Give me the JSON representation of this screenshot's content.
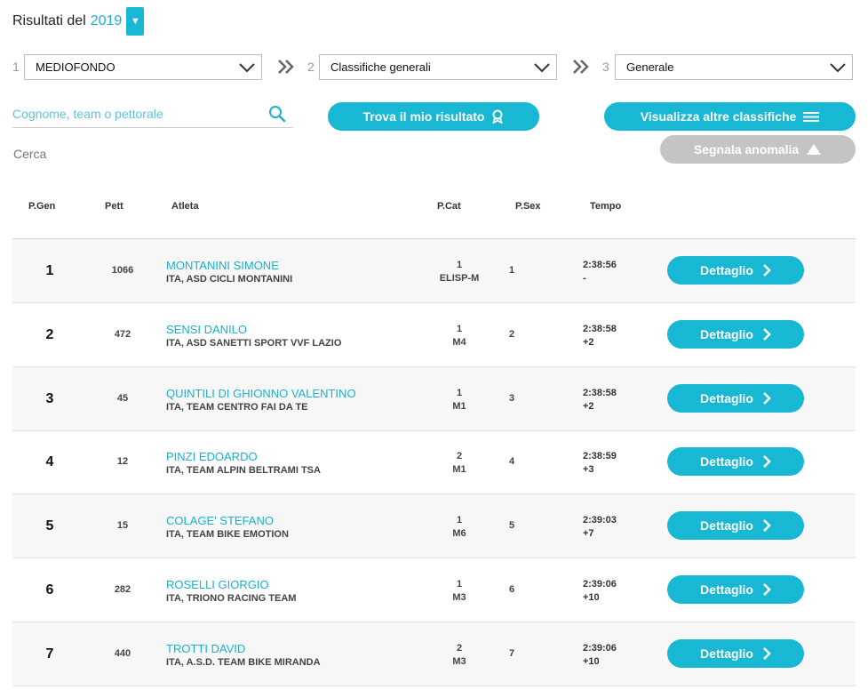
{
  "header": {
    "title": "Risultati del",
    "year": "2019",
    "year_toggle_glyph": "▼"
  },
  "steps": [
    {
      "num": "1",
      "value": "MEDIOFONDO"
    },
    {
      "num": "2",
      "value": "Classifiche generali"
    },
    {
      "num": "3",
      "value": "Generale"
    }
  ],
  "search": {
    "placeholder": "Cognome, team o pettorale",
    "value": "",
    "cerca_label": "Cerca"
  },
  "buttons": {
    "find_result": "Trova il mio risultato",
    "other_rankings": "Visualizza altre classifiche",
    "report_anomaly": "Segnala anomalia"
  },
  "table": {
    "columns": [
      "P.Gen",
      "Pett",
      "Atleta",
      "P.Cat",
      "P.Sex",
      "Tempo"
    ],
    "detail_label": "Dettaglio",
    "rows": [
      {
        "pgen": "1",
        "pett": "1066",
        "name": "MONTANINI SIMONE",
        "team": "ITA, ASD CICLI MONTANINI",
        "pcat_pos": "1",
        "pcat_cat": "ELISP-M",
        "psex": "1",
        "time": "2:38:56",
        "gap": "-"
      },
      {
        "pgen": "2",
        "pett": "472",
        "name": "SENSI DANILO",
        "team": "ITA, ASD SANETTI SPORT VVF LAZIO",
        "pcat_pos": "1",
        "pcat_cat": "M4",
        "psex": "2",
        "time": "2:38:58",
        "gap": "+2"
      },
      {
        "pgen": "3",
        "pett": "45",
        "name": "QUINTILI DI GHIONNO VALENTINO",
        "team": "ITA, TEAM CENTRO FAI DA TE",
        "pcat_pos": "1",
        "pcat_cat": "M1",
        "psex": "3",
        "time": "2:38:58",
        "gap": "+2"
      },
      {
        "pgen": "4",
        "pett": "12",
        "name": "PINZI EDOARDO",
        "team": "ITA, TEAM ALPIN BELTRAMI TSA",
        "pcat_pos": "2",
        "pcat_cat": "M1",
        "psex": "4",
        "time": "2:38:59",
        "gap": "+3"
      },
      {
        "pgen": "5",
        "pett": "15",
        "name": "COLAGE' STEFANO",
        "team": "ITA, TEAM BIKE EMOTION",
        "pcat_pos": "1",
        "pcat_cat": "M6",
        "psex": "5",
        "time": "2:39:03",
        "gap": "+7"
      },
      {
        "pgen": "6",
        "pett": "282",
        "name": "ROSELLI GIORGIO",
        "team": "ITA, TRIONO RACING TEAM",
        "pcat_pos": "1",
        "pcat_cat": "M3",
        "psex": "6",
        "time": "2:39:06",
        "gap": "+10"
      },
      {
        "pgen": "7",
        "pett": "440",
        "name": "TROTTI DAVID",
        "team": "ITA, A.S.D. TEAM BIKE MIRANDA",
        "pcat_pos": "2",
        "pcat_cat": "M3",
        "psex": "7",
        "time": "2:39:06",
        "gap": "+10"
      }
    ]
  },
  "colors": {
    "accent": "#18b7d4",
    "link": "#1ab0cf",
    "disabled": "#c4c4c4",
    "row_shade": "#f7f7f7"
  }
}
